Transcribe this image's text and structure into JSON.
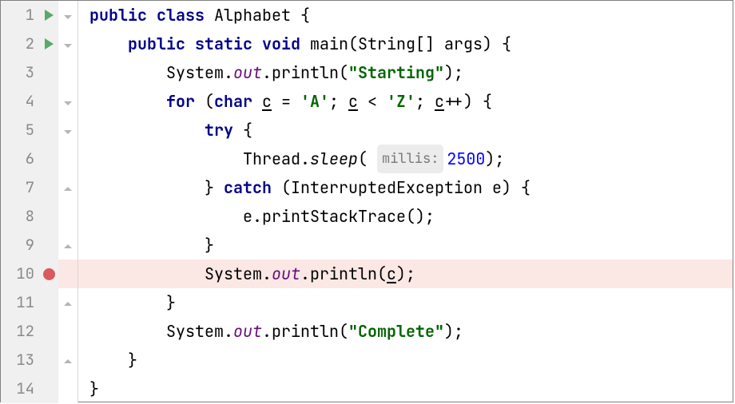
{
  "editor": {
    "breakpoint_line": 10,
    "runnable_lines": [
      1,
      2
    ],
    "lines": [
      {
        "n": 1,
        "fold": "open",
        "code": [
          {
            "t": "public",
            "c": "k"
          },
          {
            "t": " "
          },
          {
            "t": "class",
            "c": "k"
          },
          {
            "t": " Alphabet {"
          }
        ]
      },
      {
        "n": 2,
        "fold": "open",
        "code": [
          {
            "t": "    "
          },
          {
            "t": "public",
            "c": "k"
          },
          {
            "t": " "
          },
          {
            "t": "static",
            "c": "k"
          },
          {
            "t": " "
          },
          {
            "t": "void",
            "c": "k"
          },
          {
            "t": " main(String[] args) {"
          }
        ]
      },
      {
        "n": 3,
        "fold": "",
        "code": [
          {
            "t": "        System."
          },
          {
            "t": "out",
            "c": "fld"
          },
          {
            "t": ".println("
          },
          {
            "t": "\"Starting\"",
            "c": "s"
          },
          {
            "t": ");"
          }
        ]
      },
      {
        "n": 4,
        "fold": "open",
        "code": [
          {
            "t": "        "
          },
          {
            "t": "for",
            "c": "k"
          },
          {
            "t": " ("
          },
          {
            "t": "char",
            "c": "k"
          },
          {
            "t": " "
          },
          {
            "t": "c",
            "c": "u"
          },
          {
            "t": " = "
          },
          {
            "t": "'A'",
            "c": "s"
          },
          {
            "t": "; "
          },
          {
            "t": "c",
            "c": "u"
          },
          {
            "t": " < "
          },
          {
            "t": "'Z'",
            "c": "s"
          },
          {
            "t": "; "
          },
          {
            "t": "c",
            "c": "u"
          },
          {
            "t": "++) {"
          }
        ]
      },
      {
        "n": 5,
        "fold": "open",
        "code": [
          {
            "t": "            "
          },
          {
            "t": "try",
            "c": "k"
          },
          {
            "t": " {"
          }
        ]
      },
      {
        "n": 6,
        "fold": "",
        "code": [
          {
            "t": "                Thread."
          },
          {
            "t": "sleep",
            "c": "meth"
          },
          {
            "t": "( "
          },
          {
            "t": "millis:",
            "hint": true
          },
          {
            "t": "2500",
            "c": "num"
          },
          {
            "t": ");"
          }
        ]
      },
      {
        "n": 7,
        "fold": "close",
        "code": [
          {
            "t": "            } "
          },
          {
            "t": "catch",
            "c": "k"
          },
          {
            "t": " (InterruptedException e) {"
          }
        ]
      },
      {
        "n": 8,
        "fold": "",
        "code": [
          {
            "t": "                e.printStackTrace();"
          }
        ]
      },
      {
        "n": 9,
        "fold": "close",
        "code": [
          {
            "t": "            }"
          }
        ]
      },
      {
        "n": 10,
        "fold": "",
        "code": [
          {
            "t": "            System."
          },
          {
            "t": "out",
            "c": "fld"
          },
          {
            "t": ".println("
          },
          {
            "t": "c",
            "c": "u"
          },
          {
            "t": ");"
          }
        ]
      },
      {
        "n": 11,
        "fold": "close",
        "code": [
          {
            "t": "        }"
          }
        ]
      },
      {
        "n": 12,
        "fold": "",
        "code": [
          {
            "t": "        System."
          },
          {
            "t": "out",
            "c": "fld"
          },
          {
            "t": ".println("
          },
          {
            "t": "\"Complete\"",
            "c": "s"
          },
          {
            "t": ");"
          }
        ]
      },
      {
        "n": 13,
        "fold": "close",
        "code": [
          {
            "t": "    }"
          }
        ]
      },
      {
        "n": 14,
        "fold": "",
        "code": [
          {
            "t": "}"
          }
        ]
      }
    ]
  }
}
